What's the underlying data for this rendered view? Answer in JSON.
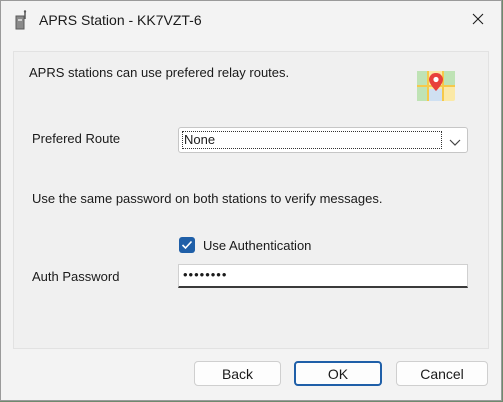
{
  "window": {
    "title": "APRS Station - KK7VZT-6",
    "app_icon": "radio-tower-icon",
    "close_icon": "close-icon"
  },
  "intro_text": "APRS stations can use prefered relay routes.",
  "map_icon": "map-pin-icon",
  "route": {
    "label": "Prefered Route",
    "selected": "None"
  },
  "auth_hint": "Use the same password on both stations to verify messages.",
  "auth": {
    "checkbox_label": "Use Authentication",
    "checked": true,
    "password_label": "Auth Password",
    "password_value": "••••••••"
  },
  "buttons": {
    "back": "Back",
    "ok": "OK",
    "cancel": "Cancel"
  },
  "colors": {
    "accent": "#1f5fa8"
  }
}
